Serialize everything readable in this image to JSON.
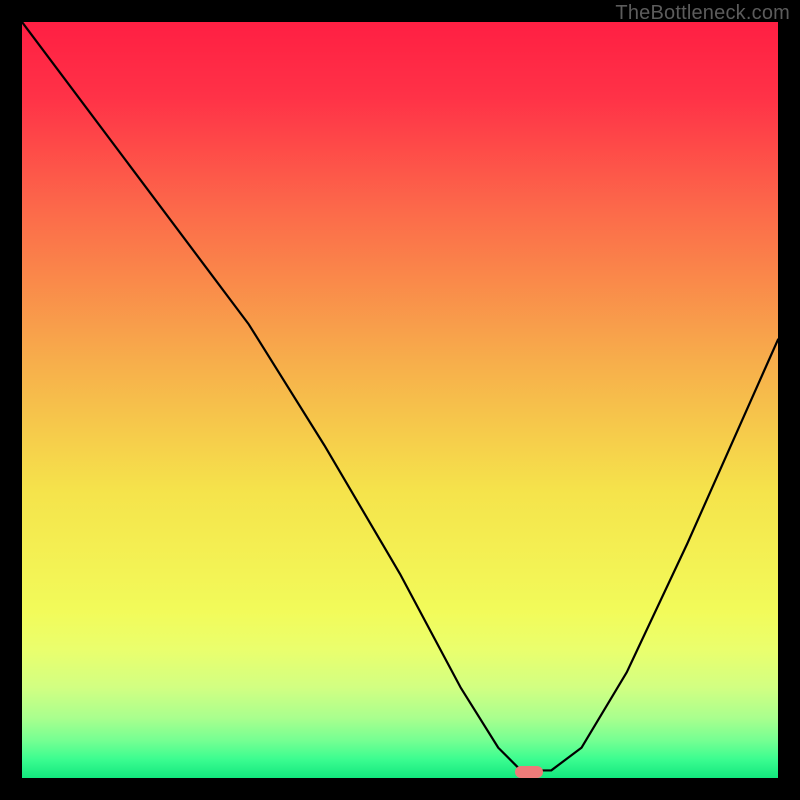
{
  "watermark": {
    "text": "TheBottleneck.com"
  },
  "marker": {
    "cx_pct": 67,
    "cy_pct": 99.2
  },
  "chart_data": {
    "type": "line",
    "title": "",
    "xlabel": "",
    "ylabel": "",
    "xlim": [
      0,
      100
    ],
    "ylim": [
      0,
      100
    ],
    "series": [
      {
        "name": "bottleneck-curve",
        "x": [
          0,
          15,
          24,
          30,
          40,
          50,
          58,
          63,
          66,
          70,
          74,
          80,
          88,
          100
        ],
        "values": [
          100,
          80,
          68,
          60,
          44,
          27,
          12,
          4,
          1,
          1,
          4,
          14,
          31,
          58
        ]
      }
    ],
    "marker": {
      "x": 67,
      "y": 0.8
    },
    "gradient_stops": [
      {
        "offset": 0.0,
        "color": "#ff1f43"
      },
      {
        "offset": 0.1,
        "color": "#ff3247"
      },
      {
        "offset": 0.25,
        "color": "#fc6a4a"
      },
      {
        "offset": 0.45,
        "color": "#f7ae4b"
      },
      {
        "offset": 0.62,
        "color": "#f5e34b"
      },
      {
        "offset": 0.78,
        "color": "#f2fb5a"
      },
      {
        "offset": 0.83,
        "color": "#eaff6d"
      },
      {
        "offset": 0.88,
        "color": "#d2ff82"
      },
      {
        "offset": 0.92,
        "color": "#aaff8e"
      },
      {
        "offset": 0.95,
        "color": "#76ff92"
      },
      {
        "offset": 0.975,
        "color": "#3cfd90"
      },
      {
        "offset": 1.0,
        "color": "#12e77e"
      }
    ]
  }
}
